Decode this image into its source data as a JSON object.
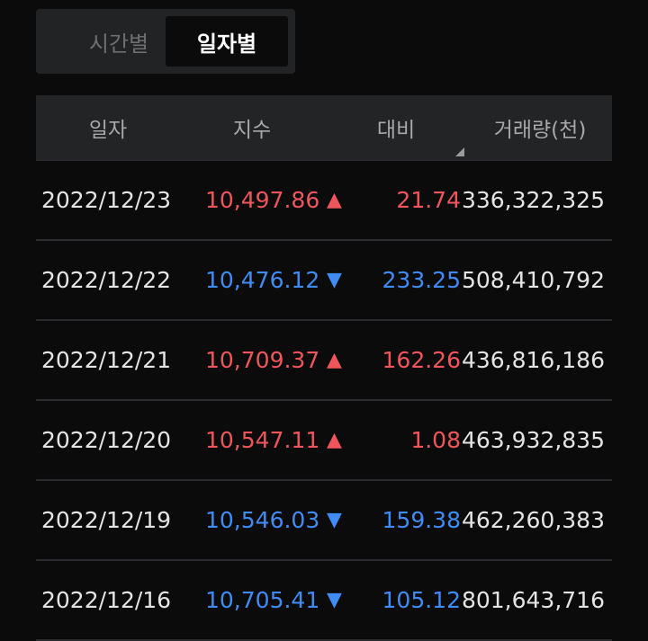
{
  "tabs": {
    "by_time": "시간별",
    "by_day": "일자별"
  },
  "table": {
    "headers": {
      "date": "일자",
      "index": "지수",
      "change": "대비",
      "volume": "거래량(천)"
    },
    "rows": [
      {
        "date": "2022/12/23",
        "index": "10,497.86",
        "arrow": "▲",
        "change": "21.74",
        "volume": "336,322,325",
        "direction": "up"
      },
      {
        "date": "2022/12/22",
        "index": "10,476.12",
        "arrow": "▼",
        "change": "233.25",
        "volume": "508,410,792",
        "direction": "down"
      },
      {
        "date": "2022/12/21",
        "index": "10,709.37",
        "arrow": "▲",
        "change": "162.26",
        "volume": "436,816,186",
        "direction": "up"
      },
      {
        "date": "2022/12/20",
        "index": "10,547.11",
        "arrow": "▲",
        "change": "1.08",
        "volume": "463,932,835",
        "direction": "up"
      },
      {
        "date": "2022/12/19",
        "index": "10,546.03",
        "arrow": "▼",
        "change": "159.38",
        "volume": "462,260,383",
        "direction": "down"
      },
      {
        "date": "2022/12/16",
        "index": "10,705.41",
        "arrow": "▼",
        "change": "105.12",
        "volume": "801,643,716",
        "direction": "down"
      }
    ]
  },
  "colors": {
    "up": "#f0555b",
    "down": "#3f8cf5",
    "background": "#0b0b0c",
    "header_bg": "#232426"
  }
}
